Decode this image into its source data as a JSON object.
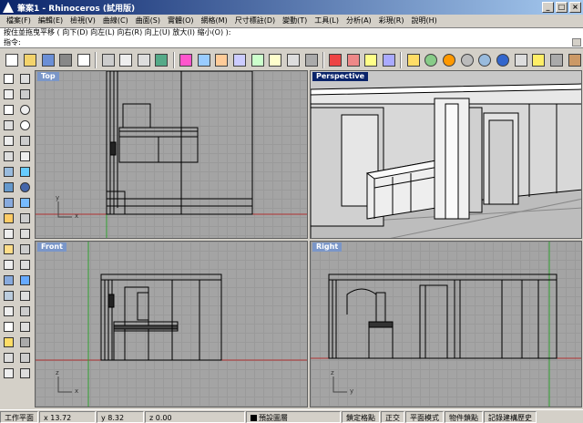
{
  "window": {
    "title": "筆案1 - Rhinoceros (試用版)",
    "minimize": "_",
    "maximize": "□",
    "close": "×"
  },
  "menu": [
    "檔案(F)",
    "編輯(E)",
    "檢視(V)",
    "曲線(C)",
    "曲面(S)",
    "實體(O)",
    "網格(M)",
    "尺寸標註(D)",
    "變動(T)",
    "工具(L)",
    "分析(A)",
    "彩現(R)",
    "說明(H)"
  ],
  "command": {
    "history": "按住並拖曳平移 ( 向下(D) 向左(L) 向右(R) 向上(U) 放大(I) 縮小(O) ):",
    "prompt": "指令:"
  },
  "toolbar_icons": [
    "new-icon",
    "open-icon",
    "save-icon",
    "print-icon",
    "import-icon",
    "cut-icon",
    "copy-icon",
    "paste-icon",
    "undo-icon",
    "pan-hand-icon",
    "rotate-view-icon",
    "zoom-dynamic-icon",
    "zoom-window-icon",
    "zoom-extents-icon",
    "zoom-selected-icon",
    "layer-icon",
    "grid-icon",
    "car-icon",
    "car2-icon",
    "bulb-icon",
    "points-icon",
    "lightbulb-icon",
    "layer-color-icon",
    "color-wheel-icon",
    "sphere-wire-icon",
    "sphere-shade-icon",
    "sphere-render-icon",
    "material-icon",
    "light-icon",
    "wrench-icon",
    "tools-icon"
  ],
  "left_toolbar_icons": [
    "select-icon",
    "point-icon",
    "polyline-icon",
    "curve-icon",
    "arc-icon",
    "circle-icon",
    "rectangle-icon",
    "ellipse-icon",
    "polygon-icon",
    "free-curve-icon",
    "text-icon",
    "offset-icon",
    "surface-icon",
    "surface-loft-icon",
    "box-icon",
    "sphere-icon",
    "cylinder-icon",
    "extrude-icon",
    "boolean-icon",
    "mesh-icon",
    "fillet-icon",
    "trim-icon",
    "split-icon",
    "join-icon",
    "explode-icon",
    "group-icon",
    "move-icon",
    "copy-obj-icon",
    "rotate-icon",
    "scale-icon",
    "mirror-icon",
    "array-icon",
    "dimension-icon",
    "analyze-icon",
    "render-icon",
    "layer-obj-icon",
    "properties-icon",
    "hide-icon",
    "lock-icon",
    "snap-icon"
  ],
  "viewports": {
    "top": {
      "label": "Top"
    },
    "perspective": {
      "label": "Perspective"
    },
    "front": {
      "label": "Front"
    },
    "right": {
      "label": "Right"
    }
  },
  "axes": {
    "y": "y",
    "x": "x",
    "z": "z"
  },
  "status": {
    "cplane": "工作平面",
    "x": "x 13.72",
    "y": "y 8.32",
    "z": "z 0.00",
    "layer": "預設圖層",
    "grid_snap": "鎖定格點",
    "ortho": "正交",
    "planar": "平面模式",
    "osnap": "物件鎖點",
    "history": "記錄建構歷史"
  },
  "colors": {
    "titlebar": "#0a246a",
    "viewport_bg": "#a4a4a4",
    "active_label": "#0a246a",
    "x_axis": "#b03030",
    "y_axis": "#30a030"
  }
}
